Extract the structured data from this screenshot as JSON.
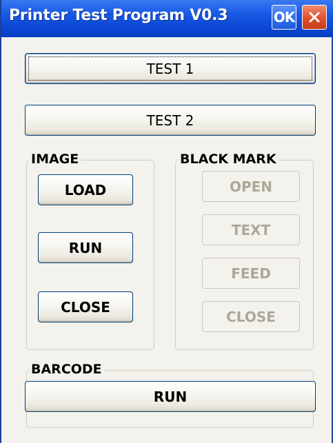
{
  "window": {
    "title": "Printer Test Program V0.3",
    "ok_label": "OK",
    "close_icon": "close-x-icon"
  },
  "buttons": {
    "test1": "TEST 1",
    "test2": "TEST 2"
  },
  "image_group": {
    "label": "IMAGE",
    "load": "LOAD",
    "run": "RUN",
    "close": "CLOSE"
  },
  "black_mark_group": {
    "label": "BLACK MARK",
    "open": "OPEN",
    "text": "TEXT",
    "feed": "FEED",
    "close": "CLOSE"
  },
  "barcode_group": {
    "label": "BARCODE",
    "run": "RUN"
  },
  "colors": {
    "title_bar": "#0a46d2",
    "window_bg": "#f3f2ec",
    "button_border": "#003c74",
    "disabled_text": "#aca899",
    "close_button": "#e0502a"
  }
}
